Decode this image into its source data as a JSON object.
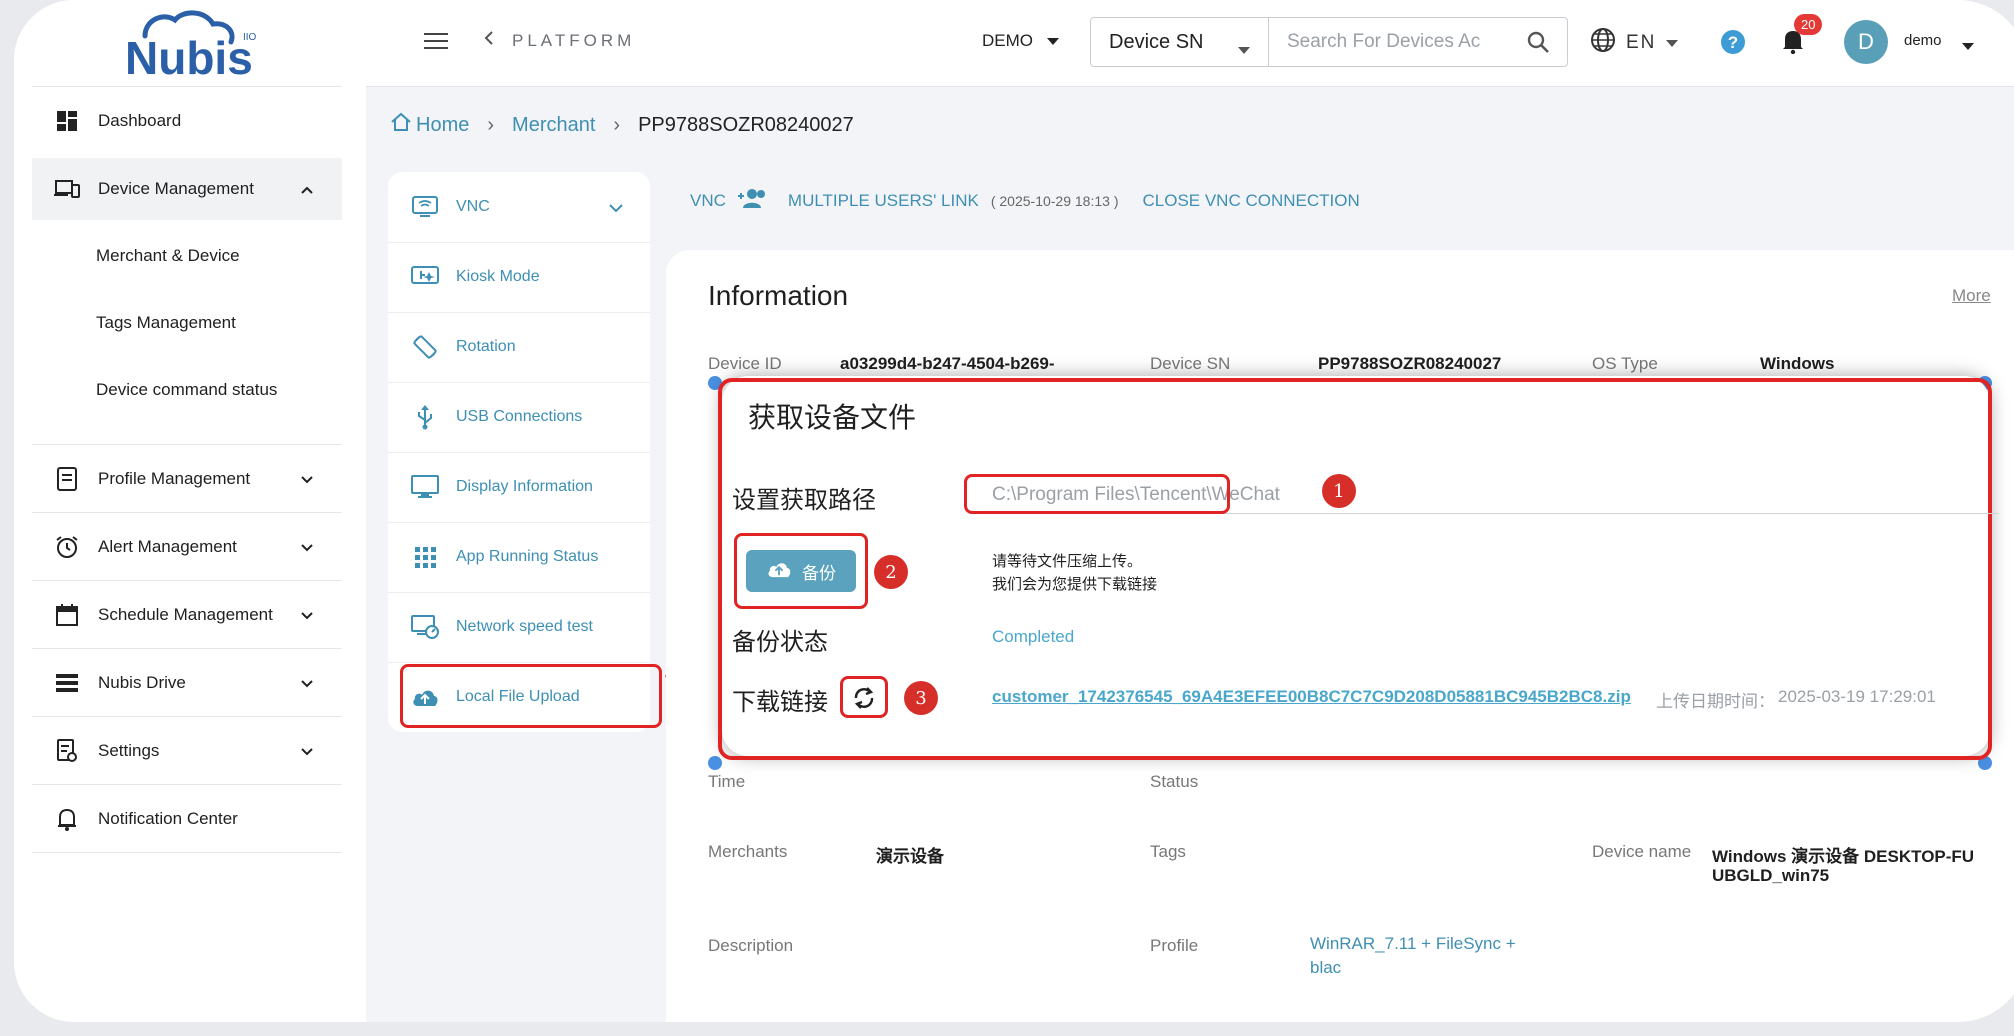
{
  "app": {
    "logo_text": "Nubis",
    "logo_sup": "IIO"
  },
  "sidebar": {
    "items": [
      {
        "label": "Dashboard"
      },
      {
        "label": "Device Management"
      },
      {
        "label": "Merchant & Device"
      },
      {
        "label": "Tags Management"
      },
      {
        "label": "Device command status"
      },
      {
        "label": "Profile Management"
      },
      {
        "label": "Alert Management"
      },
      {
        "label": "Schedule Management"
      },
      {
        "label": "Nubis Drive"
      },
      {
        "label": "Settings"
      },
      {
        "label": "Notification Center"
      }
    ]
  },
  "header": {
    "platform": "PLATFORM",
    "demo_select": "DEMO",
    "search_type": "Device SN",
    "search_placeholder": "Search For Devices Ac",
    "lang": "EN",
    "notification_count": "20",
    "avatar_letter": "D",
    "user_name": "demo"
  },
  "breadcrumb": {
    "home": "Home",
    "merchant": "Merchant",
    "current": "PP9788SOZR08240027"
  },
  "device_menu": {
    "items": [
      {
        "label": "VNC"
      },
      {
        "label": "Kiosk Mode"
      },
      {
        "label": "Rotation"
      },
      {
        "label": "USB Connections"
      },
      {
        "label": "Display Information"
      },
      {
        "label": "App Running Status"
      },
      {
        "label": "Network speed test"
      },
      {
        "label": "Local File Upload"
      }
    ]
  },
  "vnc_bar": {
    "vnc": "VNC",
    "multi_link": "MULTIPLE USERS' LINK",
    "date": "( 2025-10-29 18:13 )",
    "close": "CLOSE VNC CONNECTION"
  },
  "info": {
    "title": "Information",
    "more": "More",
    "device_id_label": "Device ID",
    "device_id_value": "a03299d4-b247-4504-b269-",
    "device_sn_label": "Device SN",
    "device_sn_value": "PP9788SOZR08240027",
    "os_type_label": "OS Type",
    "os_type_value": "Windows",
    "time_label": "Time",
    "status_label": "Status",
    "merchants_label": "Merchants",
    "merchants_value": "演示设备",
    "tags_label": "Tags",
    "device_name_label": "Device name",
    "device_name_value_1": "Windows 演示设备 DESKTOP-FU",
    "device_name_value_2": "UBGLD_win75",
    "description_label": "Description",
    "profile_label": "Profile",
    "profile_value_1": "WinRAR_7.11 + FileSync +",
    "profile_value_2": "blac"
  },
  "modal": {
    "title": "获取设备文件",
    "path_label": "设置获取路径",
    "path_value": "C:\\Program Files\\Tencent\\WeChat",
    "backup_button": "备份",
    "hint_line1": "请等待文件压缩上传。",
    "hint_line2": "我们会为您提供下载链接",
    "status_label": "备份状态",
    "status_value": "Completed",
    "download_label": "下载链接",
    "download_link": "customer_1742376545_69A4E3EFEE00B8C7C7C9D208D05881BC945B2BC8.zip",
    "upload_label": "上传日期时间：",
    "upload_time": "2025-03-19 17:29:01"
  },
  "annotations": {
    "n1": "1",
    "n2": "2",
    "n3": "3"
  },
  "colors": {
    "accent": "#3f8fb3",
    "highlight": "#e02424",
    "brand": "#2b5fa8"
  }
}
